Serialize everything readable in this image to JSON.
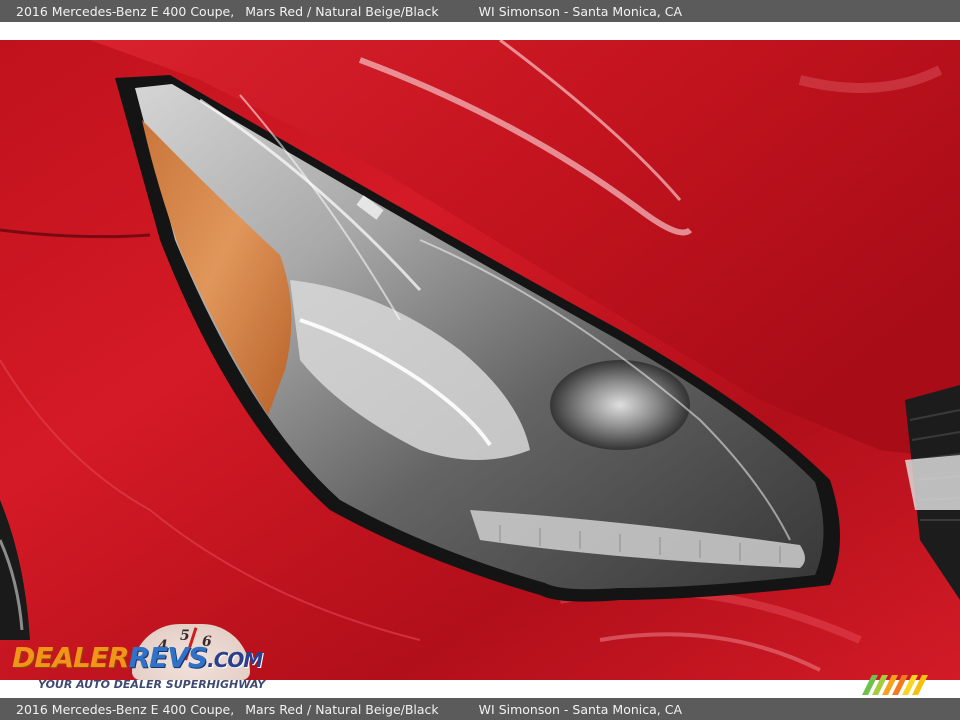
{
  "caption": {
    "model": "2016 Mercedes-Benz E 400 Coupe,",
    "color": "Mars Red / Natural Beige/Black",
    "dealer": "WI Simonson - Santa Monica, CA"
  },
  "watermark": {
    "brand_part1": "DEALER",
    "brand_part2": "REVS",
    "brand_part3": ".COM",
    "tagline": "YOUR AUTO DEALER SUPERHIGHWAY",
    "gauge_digits": [
      "4",
      "5",
      "6"
    ]
  },
  "colors": {
    "caption_bar": "#5b5b5b",
    "paint_red": "#c8141f",
    "brand_orange": "#f29419",
    "brand_blue": "#2f72c7"
  },
  "icons": {
    "stripe_logo": "multicolor-stripes-icon",
    "gauge": "speedometer-dial-icon"
  }
}
